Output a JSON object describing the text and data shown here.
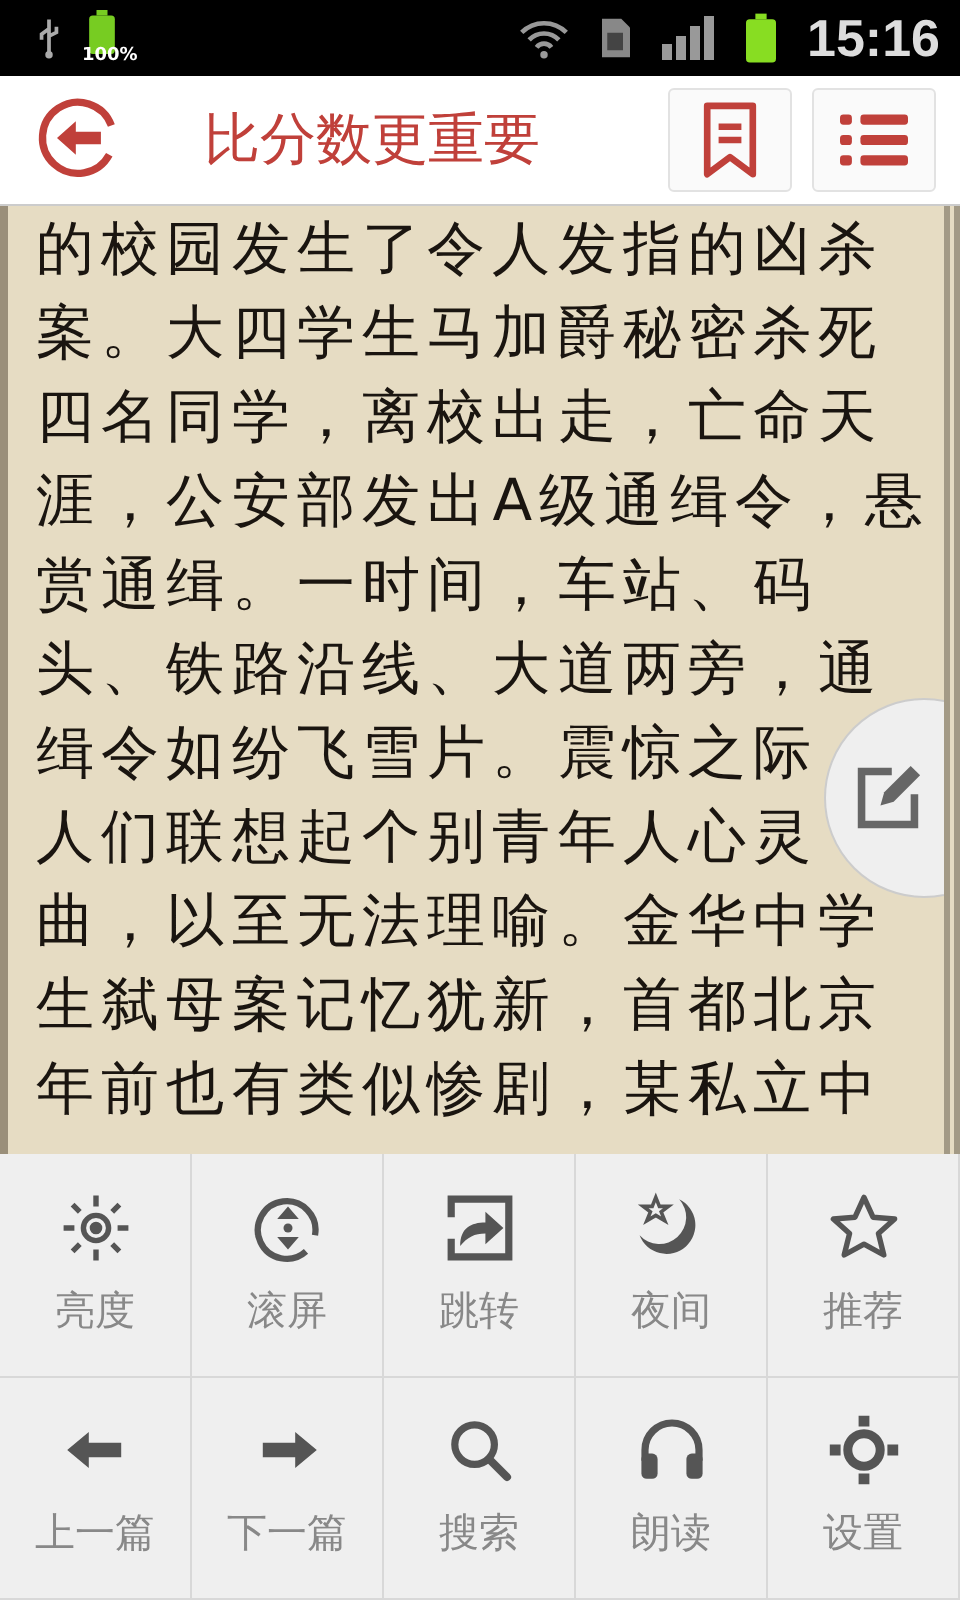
{
  "status_bar": {
    "battery_label": "100%",
    "time": "15:16"
  },
  "header": {
    "title": "比分数更重要"
  },
  "article": {
    "lines": [
      "的校园发生了令人发指的凶杀",
      "案。大四学生马加爵秘密杀死",
      "四名同学，离校出走，亡命天",
      "涯，公安部发出A级通缉令，悬",
      "赏通缉。一时间，车站、码",
      "头、铁路沿线、大道两旁，通",
      "缉令如纷飞雪片。震惊之际",
      "人们联想起个别青年人心灵",
      "曲，以至无法理喻。金华中学",
      "生弑母案记忆犹新，首都北京",
      "年前也有类似惨剧，某私立中"
    ]
  },
  "menu": {
    "items": [
      {
        "kind": "brightness",
        "label": "亮度"
      },
      {
        "kind": "scroll",
        "label": "滚屏"
      },
      {
        "kind": "jump",
        "label": "跳转"
      },
      {
        "kind": "night",
        "label": "夜间"
      },
      {
        "kind": "recommend",
        "label": "推荐"
      },
      {
        "kind": "prev",
        "label": "上一篇"
      },
      {
        "kind": "next",
        "label": "下一篇"
      },
      {
        "kind": "search",
        "label": "搜索"
      },
      {
        "kind": "read",
        "label": "朗读"
      },
      {
        "kind": "settings",
        "label": "设置"
      }
    ]
  }
}
